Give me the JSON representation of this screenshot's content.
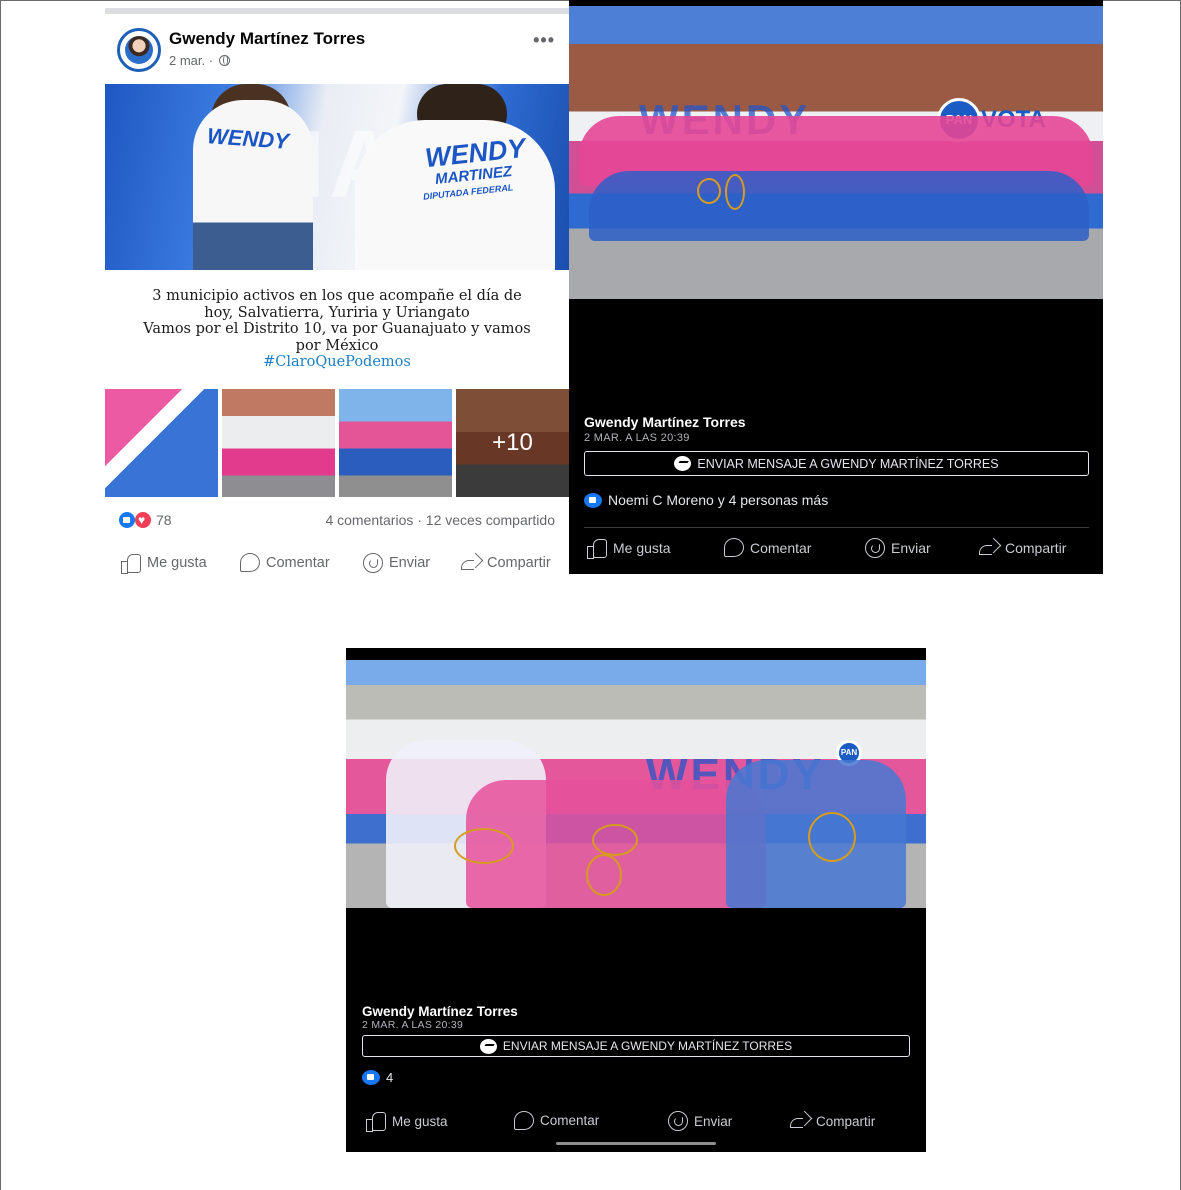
{
  "post": {
    "author": "Gwendy Martínez Torres",
    "date": "2 mar. ·",
    "more_label": "•••",
    "image_text": {
      "wall": "MA",
      "shirt_name": "WENDY",
      "shirt_surname": "MARTINEZ",
      "shirt_role": "DIPUTADA FEDERAL",
      "back_name": "WENDY"
    },
    "caption_lines": [
      "3 municipio activos en los que acompañe el día de",
      "hoy, Salvatierra, Yuriria y Uriangato",
      "Vamos por el Distrito 10, va por Guanajuato y vamos",
      "por México"
    ],
    "hashtag": "#ClaroQuePodemos",
    "thumbnails": {
      "more_count": "+10"
    },
    "reactions_count": "78",
    "comments_shares": "4 comentarios · 12 veces compartido",
    "actions": {
      "like": "Me gusta",
      "comment": "Comentar",
      "send": "Enviar",
      "share": "Compartir"
    }
  },
  "viewer1": {
    "author": "Gwendy Martínez Torres",
    "date": "2 MAR. A LAS 20:39",
    "message_button": "ENVIAR MENSAJE A GWENDY MARTÍNEZ TORRES",
    "reactions": "Noemi C Moreno y 4 personas más",
    "photo_text": {
      "wall": "WENDY",
      "pan": "PAN",
      "vota": "VOTA"
    },
    "actions": {
      "like": "Me gusta",
      "comment": "Comentar",
      "send": "Enviar",
      "share": "Compartir"
    }
  },
  "viewer2": {
    "author": "Gwendy Martínez Torres",
    "date": "2 MAR. A LAS 20:39",
    "message_button": "ENVIAR MENSAJE A GWENDY MARTÍNEZ TORRES",
    "reactions": "4",
    "photo_text": {
      "wall": "WENDY",
      "pan": "PAN"
    },
    "actions": {
      "like": "Me gusta",
      "comment": "Comentar",
      "send": "Enviar",
      "share": "Compartir"
    }
  },
  "colors": {
    "facebook_blue": "#1877f2",
    "love_red": "#f33e58",
    "annotation_circle": "#d79b1f",
    "viewer_bg": "#000000",
    "hashtag": "#1c7fc4"
  },
  "icons": [
    "globe-icon",
    "more-icon",
    "thumbs-up-icon",
    "comment-icon",
    "whatsapp-icon",
    "share-icon",
    "messenger-icon",
    "like-icon",
    "love-icon"
  ]
}
